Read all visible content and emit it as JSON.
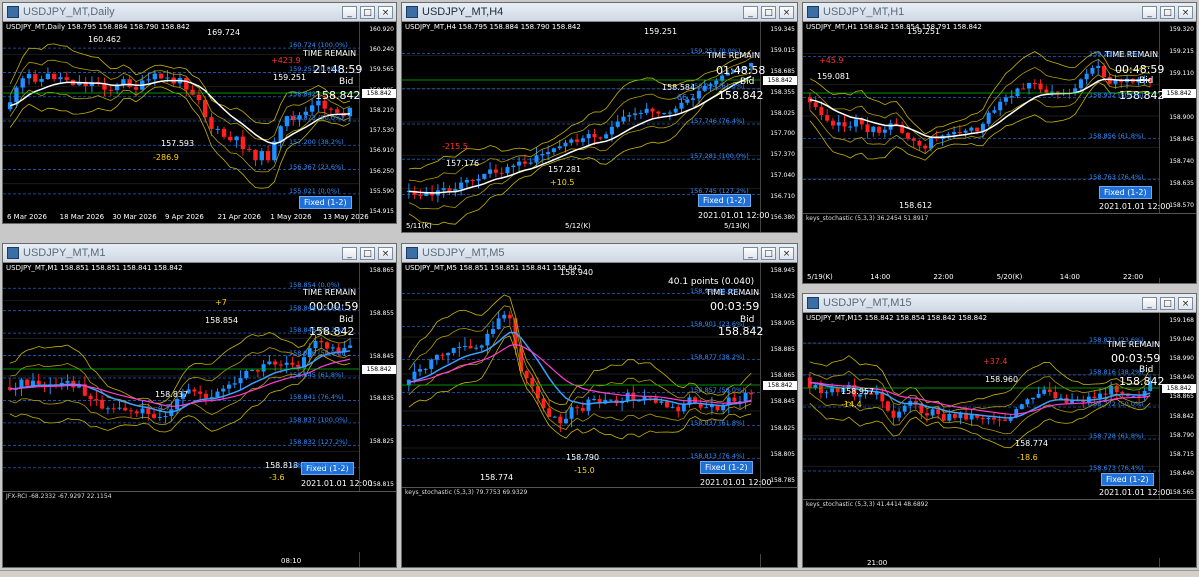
{
  "windows": {
    "daily": {
      "title": "USDJPY_MT,Daily",
      "symbol_line": "USDJPY_MT,Daily  158.795 158.884 158.790 158.842",
      "time_remain_label": "TIME REMAIN",
      "time_remain": "21:48:59",
      "bid_label": "Bid",
      "price": "158.842",
      "fixed": "Fixed (1-2)",
      "high1": "160.462",
      "high2": "169.724",
      "high3": "159.251",
      "low1": "157.593",
      "ann_up": "+423.9",
      "ann_down": "-286.9",
      "levels": [
        "160.724 (100.0%)",
        "159.251 (0.0%)",
        "158.842",
        "157.873 (50.0%)",
        "157.200 (38.2%)",
        "156.367 (23.6%)",
        "155.021 (0.0%)"
      ],
      "ticks": [
        "160.920",
        "160.240",
        "159.565",
        "158.885",
        "158.210",
        "157.530",
        "156.910",
        "156.250",
        "155.590",
        "154.915"
      ],
      "dates": [
        "6 Mar 2026",
        "18 Mar 2026",
        "30 Mar 2026",
        "9 Apr 2026",
        "21 Apr 2026",
        "1 May 2026",
        "13 May 2026"
      ]
    },
    "h4": {
      "title": "USDJPY_MT,H4",
      "symbol_line": "USDJPY_MT,H4  158.795 158.884 158.790 158.842",
      "time_remain_label": "TIME REMAIN",
      "time_remain": "01:48:58",
      "bid_label": "Bid",
      "price": "158.842",
      "fixed": "Fixed (1-2)",
      "stamp": "2021.01.01 12:00",
      "high": "159.251",
      "mid": "158.584",
      "low": "157.281",
      "low2": "157.176",
      "ann1": "-215.5",
      "ann2": "+10.5",
      "ann3": "-66.7",
      "levels": [
        "159.251 (0.0%)",
        "158.034 (61.8%)",
        "157.746 (76.4%)",
        "157.281 (100.0%)",
        "156.745 (127.2%)"
      ],
      "ticks": [
        "159.345",
        "159.015",
        "158.685",
        "158.355",
        "158.025",
        "157.700",
        "157.370",
        "157.040",
        "156.710",
        "156.380"
      ],
      "dates": [
        "5/11(K)",
        "5/12(K)",
        "5/13(K)"
      ]
    },
    "h1": {
      "title": "USDJPY_MT,H1",
      "symbol_line": "USDJPY_MT,H1  158.842 158.854 158.791 158.842",
      "time_remain_label": "TIME REMAIN",
      "time_remain": "00:48:59",
      "bid_label": "Bid",
      "price": "158.842",
      "fixed": "Fixed (1-2)",
      "stamp": "2021.01.01 12:00",
      "high": "159.251",
      "low": "158.612",
      "left": "159.081",
      "ann": "+45.9",
      "levels": [
        "159.251 (0.0%)",
        "158.932 (50.0%)",
        "158.856 (61.8%)",
        "158.763 (76.4%)"
      ],
      "ticks": [
        "159.320",
        "159.215",
        "159.110",
        "159.005",
        "158.900",
        "158.845",
        "158.740",
        "158.635",
        "158.570"
      ],
      "sub_title": "keys_stochastic (5,3,3) 36.2454 51.8917",
      "sub_ticks": [
        "98.94",
        "19.5179"
      ],
      "dates": [
        "5/19(K)",
        "14:00",
        "22:00",
        "5/20(K)",
        "14:00",
        "22:00"
      ]
    },
    "m1": {
      "title": "USDJPY_MT,M1",
      "symbol_line": "USDJPY_MT,M1  158.851 158.851 158.841 158.842",
      "time_remain_label": "TIME REMAIN",
      "time_remain": "00:00:59",
      "bid_label": "Bid",
      "price": "158.842",
      "fixed": "Fixed (1-2)",
      "stamp": "2021.01.01 12:00",
      "high": "158.854",
      "mid": "158.837",
      "low": "158.818",
      "ann1": "+7",
      "ann2": "-4.7",
      "ann3": "-3.6",
      "levels": [
        "158.854 (0.0%)",
        "158.848 (23.6%)",
        "158.846 (38.2%)",
        "158.846 (50.0%)",
        "158.845 (61.8%)",
        "158.841 (76.4%)",
        "158.837 (100.0%)",
        "158.832 (127.2%)",
        "158.826 (161.8%)"
      ],
      "ticks": [
        "158.865",
        "158.855",
        "158.845",
        "158.835",
        "158.825",
        "158.815"
      ],
      "sub_title": "JFX-RCI  -68.2332  -67.9297  22.1154",
      "sub_ticks": [
        "0.00"
      ],
      "time": "08:10"
    },
    "m5": {
      "title": "USDJPY_MT,M5",
      "symbol_line": "USDJPY_MT,M5  158.851 158.851 158.841 158.842",
      "points": "40.1 points (0.040)",
      "time_remain_label": "TIME REMAIN",
      "time_remain": "00:03:59",
      "bid_label": "Bid",
      "price": "158.842",
      "fixed": "Fixed (1-2)",
      "stamp": "2021.01.01 12:00",
      "high": "158.940",
      "low1": "158.774",
      "low2": "158.790",
      "ann": "-15.0",
      "levels": [
        "158.940 (0.0%)",
        "158.901 (23.6%)",
        "158.877 (38.2%)",
        "158.857 (50.0%)",
        "158.837 (61.8%)",
        "158.813 (76.4%)"
      ],
      "ticks": [
        "158.945",
        "158.925",
        "158.905",
        "158.885",
        "158.865",
        "158.845",
        "158.825",
        "158.805",
        "158.785"
      ],
      "sub_title": "keys_stochastic (5,3,3) 79.7753 69.9329",
      "sub_ticks": [
        "98.0669",
        "17.7659"
      ]
    },
    "m15": {
      "title": "USDJPY_MT,M15",
      "symbol_line": "USDJPY_MT,M15  158.842 158.854 158.842 158.842",
      "time_remain_label": "TIME REMAIN",
      "time_remain": "00:03:59",
      "bid_label": "Bid",
      "price": "158.842",
      "fixed": "Fixed (1-2)",
      "stamp": "2021.01.01 12:00",
      "high": "158.960",
      "mid": "158.957",
      "low": "158.774",
      "ann1": "+37.4",
      "ann2": "-14.4",
      "ann3": "-18.6",
      "levels": [
        "158.871 (23.6%)",
        "158.816 (38.2%)",
        "158.772 (50.0%)",
        "158.728 (61.8%)",
        "158.673 (76.4%)"
      ],
      "ticks": [
        "159.168",
        "159.040",
        "158.990",
        "158.940",
        "158.865",
        "158.842",
        "158.790",
        "158.715",
        "158.640",
        "158.565"
      ],
      "sub_title": "keys_stochastic (5,3,3) 41.4414 48.6892",
      "sub_ticks": [
        "96.4446",
        "80",
        "18.3472"
      ],
      "time": "21:00"
    }
  }
}
